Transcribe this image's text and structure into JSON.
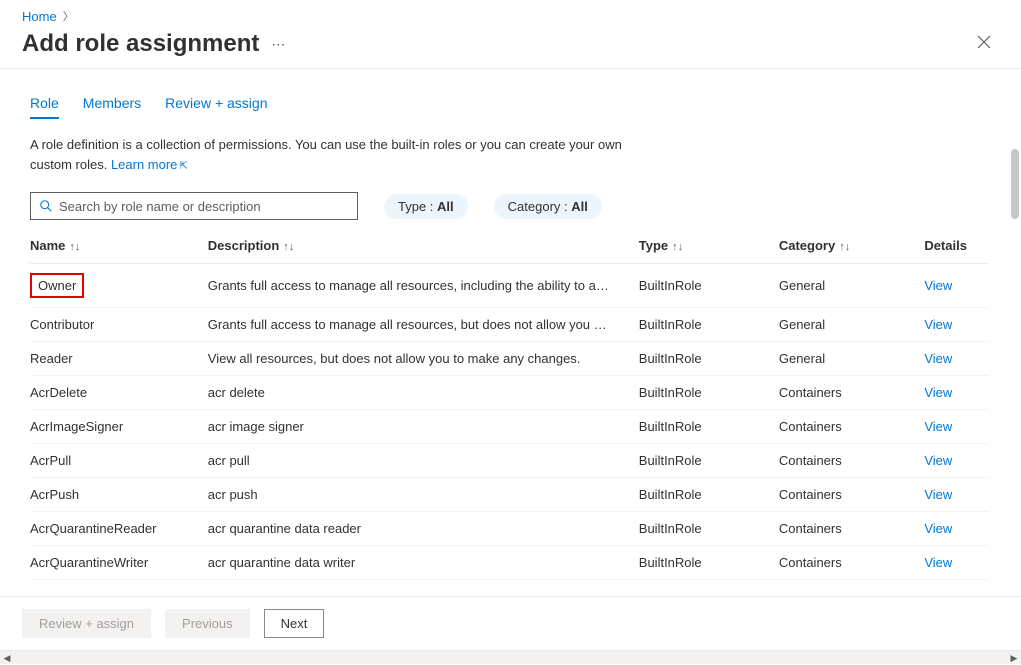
{
  "breadcrumb": {
    "home": "Home"
  },
  "header": {
    "title": "Add role assignment",
    "more": "⋯"
  },
  "tabs": {
    "role": "Role",
    "members": "Members",
    "review": "Review + assign"
  },
  "description": "A role definition is a collection of permissions. You can use the built-in roles or you can create your own custom roles.",
  "learn_more": "Learn more",
  "search": {
    "placeholder": "Search by role name or description"
  },
  "filters": {
    "type_label": "Type : ",
    "type_value": "All",
    "category_label": "Category : ",
    "category_value": "All"
  },
  "columns": {
    "name": "Name",
    "description": "Description",
    "type": "Type",
    "category": "Category",
    "details": "Details"
  },
  "view_label": "View",
  "roles": [
    {
      "name": "Owner",
      "description": "Grants full access to manage all resources, including the ability to a…",
      "type": "BuiltInRole",
      "category": "General",
      "highlight": true
    },
    {
      "name": "Contributor",
      "description": "Grants full access to manage all resources, but does not allow you …",
      "type": "BuiltInRole",
      "category": "General"
    },
    {
      "name": "Reader",
      "description": "View all resources, but does not allow you to make any changes.",
      "type": "BuiltInRole",
      "category": "General"
    },
    {
      "name": "AcrDelete",
      "description": "acr delete",
      "type": "BuiltInRole",
      "category": "Containers"
    },
    {
      "name": "AcrImageSigner",
      "description": "acr image signer",
      "type": "BuiltInRole",
      "category": "Containers"
    },
    {
      "name": "AcrPull",
      "description": "acr pull",
      "type": "BuiltInRole",
      "category": "Containers"
    },
    {
      "name": "AcrPush",
      "description": "acr push",
      "type": "BuiltInRole",
      "category": "Containers"
    },
    {
      "name": "AcrQuarantineReader",
      "description": "acr quarantine data reader",
      "type": "BuiltInRole",
      "category": "Containers"
    },
    {
      "name": "AcrQuarantineWriter",
      "description": "acr quarantine data writer",
      "type": "BuiltInRole",
      "category": "Containers"
    }
  ],
  "footer": {
    "review": "Review + assign",
    "previous": "Previous",
    "next": "Next"
  }
}
